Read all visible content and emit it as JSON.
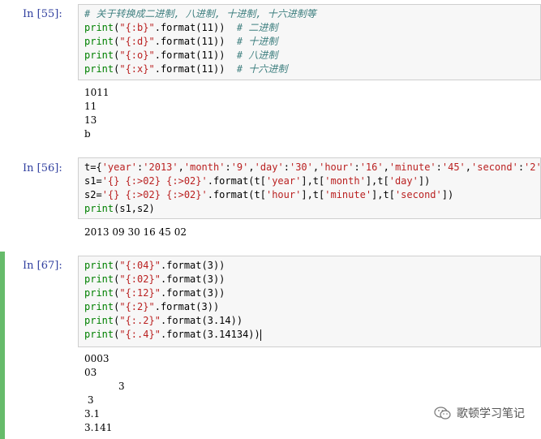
{
  "cells": [
    {
      "prompt": "In [55]:",
      "lines": [
        {
          "segments": [
            {
              "t": "# 关于转换成二进制, 八进制, 十进制, 十六进制等",
              "c": "cm"
            }
          ]
        },
        {
          "segments": [
            {
              "t": "print",
              "c": "kw"
            },
            {
              "t": "(",
              "c": ""
            },
            {
              "t": "\"{:b}\"",
              "c": "str"
            },
            {
              "t": ".format(11))  ",
              "c": ""
            },
            {
              "t": "# 二进制",
              "c": "cm"
            }
          ]
        },
        {
          "segments": [
            {
              "t": "print",
              "c": "kw"
            },
            {
              "t": "(",
              "c": ""
            },
            {
              "t": "\"{:d}\"",
              "c": "str"
            },
            {
              "t": ".format(11))  ",
              "c": ""
            },
            {
              "t": "# 十进制",
              "c": "cm"
            }
          ]
        },
        {
          "segments": [
            {
              "t": "print",
              "c": "kw"
            },
            {
              "t": "(",
              "c": ""
            },
            {
              "t": "\"{:o}\"",
              "c": "str"
            },
            {
              "t": ".format(11))  ",
              "c": ""
            },
            {
              "t": "# 八进制",
              "c": "cm"
            }
          ]
        },
        {
          "segments": [
            {
              "t": "print",
              "c": "kw"
            },
            {
              "t": "(",
              "c": ""
            },
            {
              "t": "\"{:x}\"",
              "c": "str"
            },
            {
              "t": ".format(11))  ",
              "c": ""
            },
            {
              "t": "# 十六进制",
              "c": "cm"
            }
          ]
        }
      ],
      "output": [
        "1011",
        "11",
        "13",
        "b"
      ]
    },
    {
      "prompt": "In [56]:",
      "lines": [
        {
          "segments": [
            {
              "t": "t={",
              "c": ""
            },
            {
              "t": "'year'",
              "c": "str"
            },
            {
              "t": ":",
              "c": ""
            },
            {
              "t": "'2013'",
              "c": "str"
            },
            {
              "t": ",",
              "c": ""
            },
            {
              "t": "'month'",
              "c": "str"
            },
            {
              "t": ":",
              "c": ""
            },
            {
              "t": "'9'",
              "c": "str"
            },
            {
              "t": ",",
              "c": ""
            },
            {
              "t": "'day'",
              "c": "str"
            },
            {
              "t": ":",
              "c": ""
            },
            {
              "t": "'30'",
              "c": "str"
            },
            {
              "t": ",",
              "c": ""
            },
            {
              "t": "'hour'",
              "c": "str"
            },
            {
              "t": ":",
              "c": ""
            },
            {
              "t": "'16'",
              "c": "str"
            },
            {
              "t": ",",
              "c": ""
            },
            {
              "t": "'minute'",
              "c": "str"
            },
            {
              "t": ":",
              "c": ""
            },
            {
              "t": "'45'",
              "c": "str"
            },
            {
              "t": ",",
              "c": ""
            },
            {
              "t": "'second'",
              "c": "str"
            },
            {
              "t": ":",
              "c": ""
            },
            {
              "t": "'2'",
              "c": "str"
            },
            {
              "t": "}",
              "c": ""
            }
          ]
        },
        {
          "segments": [
            {
              "t": "s1=",
              "c": ""
            },
            {
              "t": "'{} {:>02} {:>02}'",
              "c": "str"
            },
            {
              "t": ".format(t[",
              "c": ""
            },
            {
              "t": "'year'",
              "c": "str"
            },
            {
              "t": "],t[",
              "c": ""
            },
            {
              "t": "'month'",
              "c": "str"
            },
            {
              "t": "],t[",
              "c": ""
            },
            {
              "t": "'day'",
              "c": "str"
            },
            {
              "t": "])",
              "c": ""
            }
          ]
        },
        {
          "segments": [
            {
              "t": "s2=",
              "c": ""
            },
            {
              "t": "'{} {:>02} {:>02}'",
              "c": "str"
            },
            {
              "t": ".format(t[",
              "c": ""
            },
            {
              "t": "'hour'",
              "c": "str"
            },
            {
              "t": "],t[",
              "c": ""
            },
            {
              "t": "'minute'",
              "c": "str"
            },
            {
              "t": "],t[",
              "c": ""
            },
            {
              "t": "'second'",
              "c": "str"
            },
            {
              "t": "])",
              "c": ""
            }
          ]
        },
        {
          "segments": [
            {
              "t": "print",
              "c": "kw"
            },
            {
              "t": "(s1,s2)",
              "c": ""
            }
          ]
        }
      ],
      "output": [
        "2013 09 30 16 45 02"
      ]
    },
    {
      "prompt": "In [67]:",
      "lines": [
        {
          "segments": [
            {
              "t": "print",
              "c": "kw"
            },
            {
              "t": "(",
              "c": ""
            },
            {
              "t": "\"{:04}\"",
              "c": "str"
            },
            {
              "t": ".format(3))",
              "c": ""
            }
          ]
        },
        {
          "segments": [
            {
              "t": "print",
              "c": "kw"
            },
            {
              "t": "(",
              "c": ""
            },
            {
              "t": "\"{:02}\"",
              "c": "str"
            },
            {
              "t": ".format(3))",
              "c": ""
            }
          ]
        },
        {
          "segments": [
            {
              "t": "print",
              "c": "kw"
            },
            {
              "t": "(",
              "c": ""
            },
            {
              "t": "\"{:12}\"",
              "c": "str"
            },
            {
              "t": ".format(3))",
              "c": ""
            }
          ]
        },
        {
          "segments": [
            {
              "t": "print",
              "c": "kw"
            },
            {
              "t": "(",
              "c": ""
            },
            {
              "t": "\"{:2}\"",
              "c": "str"
            },
            {
              "t": ".format(3))",
              "c": ""
            }
          ]
        },
        {
          "segments": [
            {
              "t": "print",
              "c": "kw"
            },
            {
              "t": "(",
              "c": ""
            },
            {
              "t": "\"{:.2}\"",
              "c": "str"
            },
            {
              "t": ".format(3.14))",
              "c": ""
            }
          ]
        },
        {
          "segments": [
            {
              "t": "print",
              "c": "kw"
            },
            {
              "t": "(",
              "c": ""
            },
            {
              "t": "\"{:.4}\"",
              "c": "str"
            },
            {
              "t": ".format(3.14134))",
              "c": ""
            }
          ]
        }
      ],
      "output": [
        "0003",
        "03",
        "           3",
        " 3",
        "3.1",
        "3.141"
      ]
    }
  ],
  "watermark": {
    "text": "歌顿学习笔记",
    "icon": "wechat-icon"
  },
  "colors": {
    "prompt": "#303f9f",
    "keyword": "#008000",
    "string": "#ba2121",
    "comment": "#408080",
    "selected_border": "#66bb6a"
  }
}
